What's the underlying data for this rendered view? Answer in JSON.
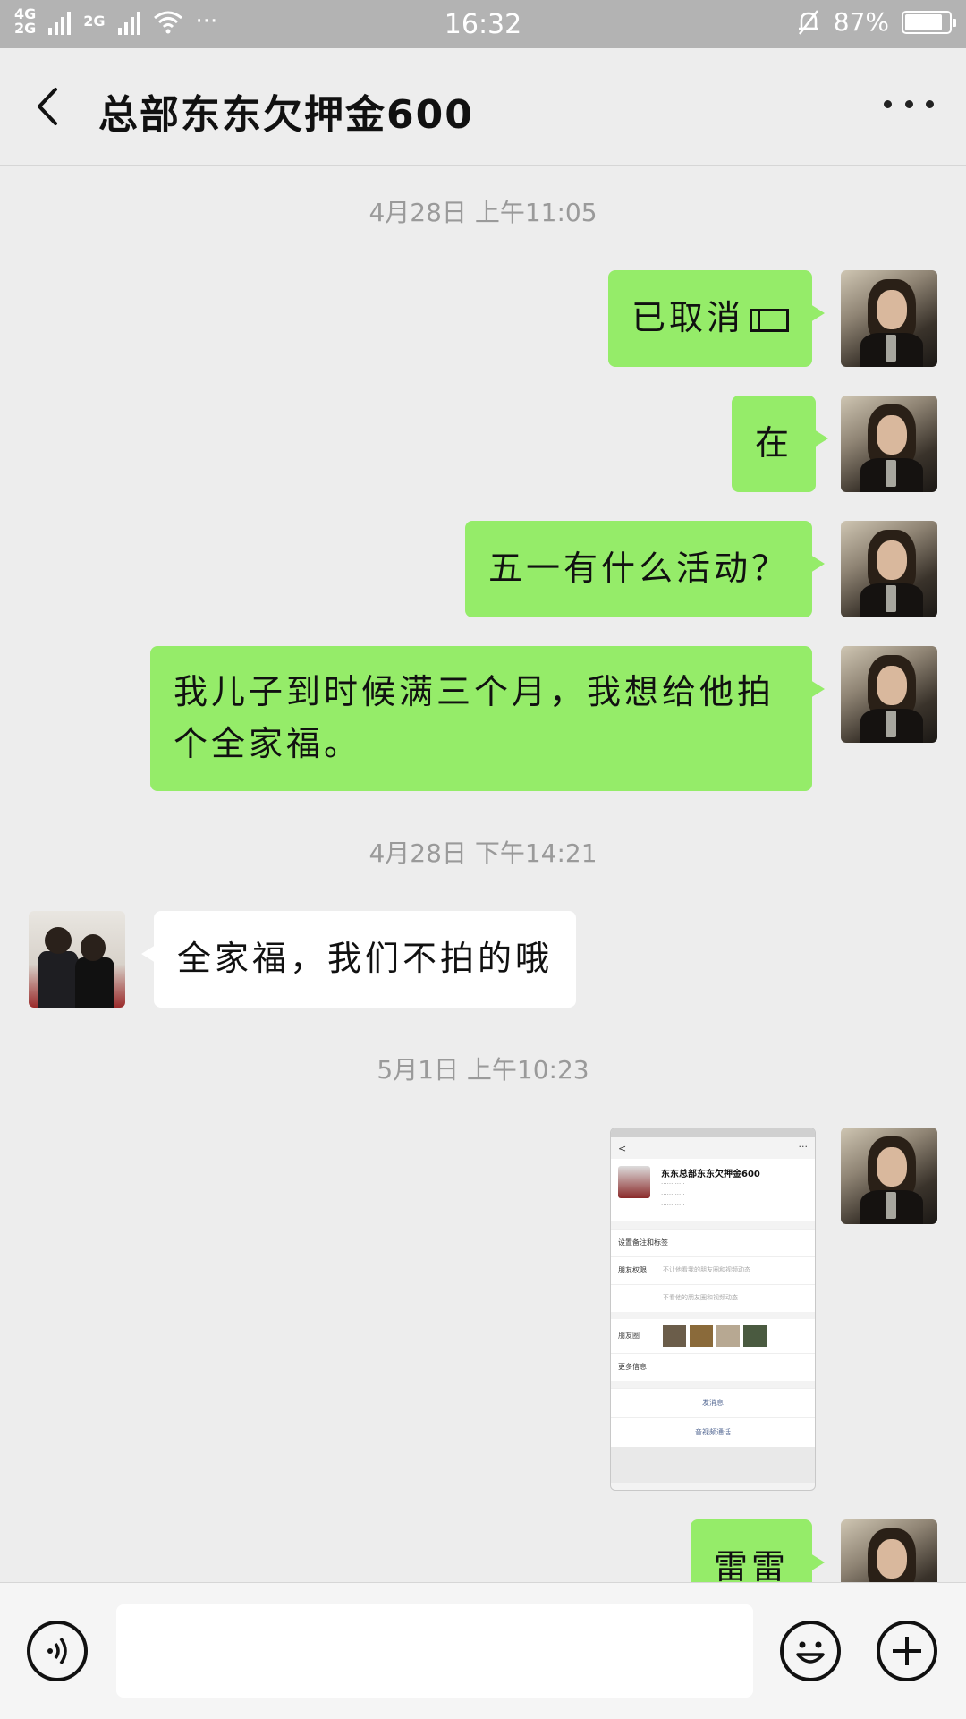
{
  "status_bar": {
    "network_left": "4G",
    "network_left2": "2G",
    "network_right": "2G",
    "time": "16:32",
    "battery": "87%",
    "battery_level": 0.87,
    "more": "···"
  },
  "header": {
    "title": "总部东东欠押金600"
  },
  "messages": {
    "ts1": "4月28日 上午11:05",
    "m1": "已取消",
    "m2": "在",
    "m3": "五一有什么活动？",
    "m4": "我儿子到时候满三个月，我想给他拍个全家福。",
    "ts2": "4月28日 下午14:21",
    "m5": "全家福，我们不拍的哦",
    "ts3": "5月1日 上午10:23",
    "m6": "雷雷"
  },
  "screenshot_message": {
    "name": "东东总部东东欠押金600",
    "row1": "设置备注和标签",
    "row2_label": "朋友权限",
    "row2_value": "不让他看我的朋友圈和视频动态",
    "row3_value": "不看他的朋友圈和视频动态",
    "moments_label": "朋友圈",
    "more_info": "更多信息",
    "send_message": "发消息",
    "video_call": "音视频通话"
  },
  "input_bar": {
    "placeholder": ""
  }
}
